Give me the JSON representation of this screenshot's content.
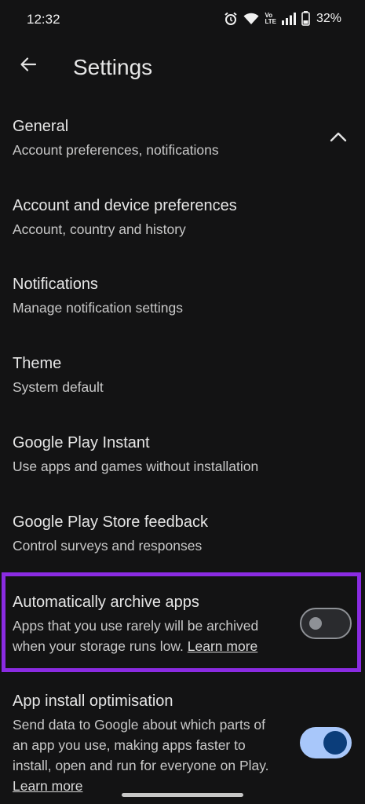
{
  "status_bar": {
    "time": "12:32",
    "battery_percent": "32%",
    "icons": [
      "alarm-icon",
      "wifi-icon",
      "volte-icon",
      "signal-icon",
      "battery-icon"
    ],
    "volte_top": "Vo",
    "volte_bottom": "LTE"
  },
  "app_bar": {
    "back_icon": "arrow-back-icon",
    "title": "Settings"
  },
  "general": {
    "title": "General",
    "subtitle": "Account preferences, notifications",
    "expand_icon": "chevron-up-icon",
    "expanded": true
  },
  "items": [
    {
      "title": "Account and device preferences",
      "subtitle": "Account, country and history"
    },
    {
      "title": "Notifications",
      "subtitle": "Manage notification settings"
    },
    {
      "title": "Theme",
      "subtitle": "System default"
    },
    {
      "title": "Google Play Instant",
      "subtitle": "Use apps and games without installation"
    },
    {
      "title": "Google Play Store feedback",
      "subtitle": "Control surveys and responses"
    }
  ],
  "archive": {
    "title": "Automatically archive apps",
    "subtitle_line1": "Apps that you use rarely will be archived",
    "subtitle_line2": "when your storage runs low.",
    "link": "Learn more",
    "enabled": false
  },
  "install_opt": {
    "title": "App install optimisation",
    "line1": "Send data to Google about which parts of",
    "line2": "an app you use, making apps faster to",
    "line3": "install, open and run for everyone on Play.",
    "link": "Learn more",
    "enabled": true
  },
  "colors": {
    "background": "#131314",
    "highlight_border": "#8a2be2",
    "toggle_on_track": "#a8c7fa",
    "toggle_on_knob": "#0b3d7a"
  }
}
